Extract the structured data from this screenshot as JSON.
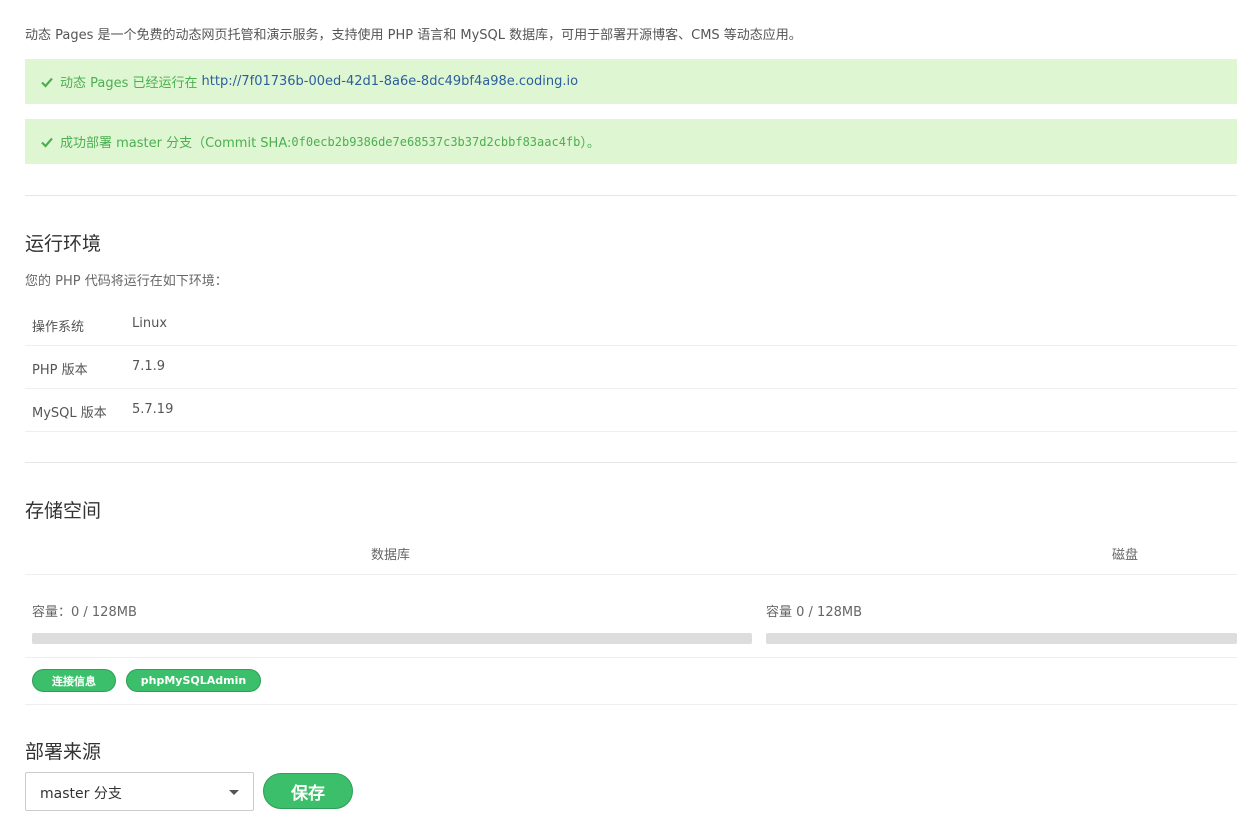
{
  "intro": "动态 Pages 是一个免费的动态网页托管和演示服务，支持使用 PHP 语言和 MySQL 数据库，可用于部署开源博客、CMS 等动态应用。",
  "alerts": {
    "running_prefix": "动态 Pages 已经运行在",
    "running_url": "http://7f01736b-00ed-42d1-8a6e-8dc49bf4a98e.coding.io",
    "deploy_prefix": "成功部署 master 分支（Commit SHA: ",
    "deploy_sha": "0f0ecb2b9386de7e68537c3b37d2cbbf83aac4fb",
    "deploy_suffix": "）。"
  },
  "env": {
    "title": "运行环境",
    "subtitle": "您的 PHP 代码将运行在如下环境：",
    "rows": [
      {
        "key": "操作系统",
        "value": "Linux"
      },
      {
        "key": "PHP 版本",
        "value": "7.1.9"
      },
      {
        "key": "MySQL 版本",
        "value": "5.7.19"
      }
    ]
  },
  "storage": {
    "title": "存储空间",
    "db_header": "数据库",
    "disk_header": "磁盘",
    "db_capacity": "容量：0 / 128MB",
    "disk_capacity": "容量 0 / 128MB",
    "db_usage_fraction": 0,
    "disk_usage_fraction": 0,
    "btn_connect": "连接信息",
    "btn_admin": "phpMySQLAdmin"
  },
  "deploy": {
    "title": "部署来源",
    "selected": "master 分支",
    "save": "保存"
  },
  "colors": {
    "accent": "#3cbf6a",
    "alert_bg": "#dff6d2",
    "alert_text": "#4caf50",
    "link": "#2b5f9e"
  }
}
